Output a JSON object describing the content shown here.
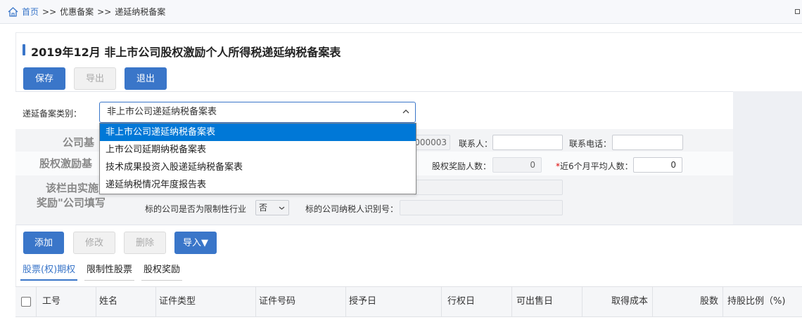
{
  "breadcrumb": {
    "home": "首页",
    "sep": ">>",
    "level1": "优惠备案",
    "level2": "递延纳税备案"
  },
  "page_title": "2019年12月  非上市公司股权激励个人所得税递延纳税备案表",
  "toolbar": {
    "save": "保存",
    "export": "导出",
    "exit": "退出"
  },
  "form": {
    "category_label": "递延备案类别：",
    "category_value": "非上市公司递延纳税备案表",
    "dropdown_options": [
      "非上市公司递延纳税备案表",
      "上市公司延期纳税备案表",
      "技术成果投资入股递延纳税备案表",
      "递延纳税情况年度报告表"
    ],
    "section_company_basic": "公司基",
    "section_equity_basic": "股权激励基",
    "section_note_line1": "该栏由实施",
    "section_note_line2": "奖励\"公司填写",
    "taxpayer_id_tail": "000003",
    "contact_label": "联系人：",
    "contact_value": "",
    "phone_label": "联系电话：",
    "phone_value": "",
    "equity_reward_count_label": "股权奖励人数：",
    "equity_reward_count_value": "0",
    "avg_6m_required": "*",
    "avg_6m_label": "近6个月平均人数：",
    "avg_6m_value": "0",
    "restricted_industry_label": "标的公司是否为限制性行业",
    "restricted_industry_value": "否",
    "target_taxpayer_id_label": "标的公司纳税人识别号：",
    "target_taxpayer_id_value": ""
  },
  "grid_toolbar": {
    "add": "添加",
    "edit": "修改",
    "delete": "删除",
    "import": "导入▼"
  },
  "tabs": [
    "股票(权)期权",
    "限制性股票",
    "股权奖励"
  ],
  "table": {
    "columns": [
      "工号",
      "姓名",
      "证件类型",
      "证件号码",
      "授予日",
      "行权日",
      "可出售日",
      "取得成本",
      "股数",
      "持股比例（%)"
    ]
  },
  "colors": {
    "primary": "#3a76c9",
    "dropdown_selected": "#0078d7"
  }
}
